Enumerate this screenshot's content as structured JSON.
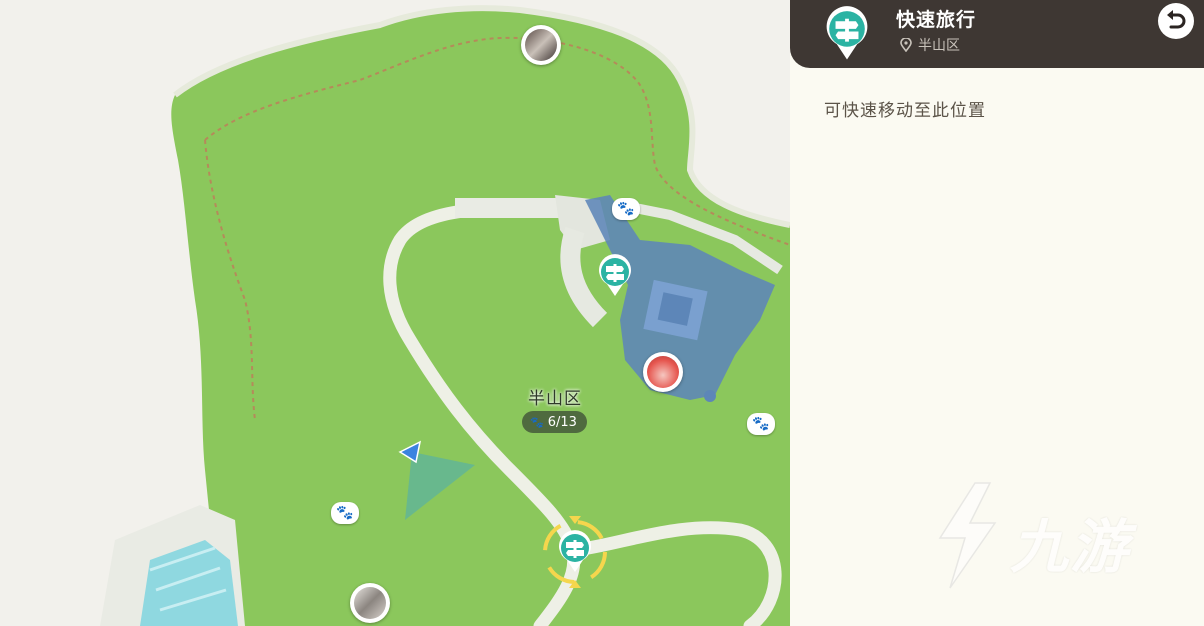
{
  "map": {
    "area_name": "半山区",
    "area_progress": "6/13"
  },
  "panel": {
    "title": "快速旅行",
    "location": "半山区",
    "description": "可快速移动至此位置"
  },
  "watermark": {
    "text": "九游"
  },
  "colors": {
    "grass": "#8bc75c",
    "path": "#eef0e6",
    "building": "#5d86b8",
    "waypoint": "#2bb3a3",
    "header": "#3e3733",
    "panel_bg": "#fbfaf2",
    "water": "#8fd8e0"
  },
  "icons": {
    "fast_travel": "signpost-icon",
    "location": "map-pin-icon",
    "back": "return-arrow-icon",
    "paw": "paw-icon",
    "player": "player-arrow-icon"
  }
}
